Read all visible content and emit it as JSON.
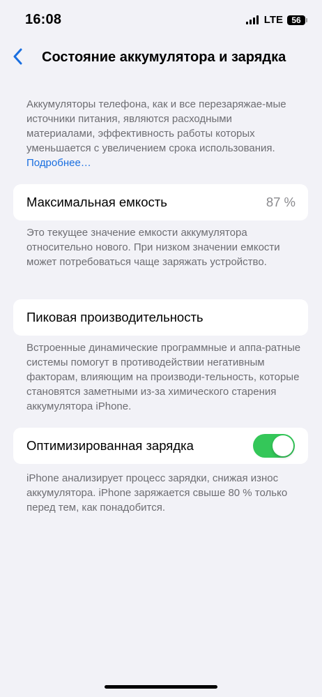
{
  "status_bar": {
    "time": "16:08",
    "network": "LTE",
    "battery_level": "56"
  },
  "nav": {
    "back_icon": "chevron-left-icon",
    "title": "Состояние аккумулятора и зарядка"
  },
  "intro": {
    "text": "Аккумуляторы телефона, как и все перезаряжае-мые источники питания, являются расходными материалами, эффективность работы которых уменьшается с увеличением срока использования.",
    "link_label": "Подробнее…"
  },
  "max_capacity": {
    "label": "Максимальная емкость",
    "value": "87 %",
    "footer": "Это текущее значение емкости аккумулятора относительно нового. При низком значении емкости может потребоваться чаще заряжать устройство."
  },
  "peak_performance": {
    "label": "Пиковая производительность",
    "footer": "Встроенные динамические программные и аппа-ратные системы помогут в противодействии негативным факторам, влияющим на производи-тельность, которые становятся заметными из-за химического старения аккумулятора iPhone."
  },
  "optimized_charging": {
    "label": "Оптимизированная зарядка",
    "enabled": true,
    "toggle_color": "#34C759",
    "footer": "iPhone анализирует процесс зарядки, снижая износ аккумулятора. iPhone заряжается свыше 80 % только перед тем, как понадобится."
  },
  "colors": {
    "background": "#F2F2F7",
    "link": "#1A6FE0",
    "secondary_text": "#6D6D72"
  }
}
